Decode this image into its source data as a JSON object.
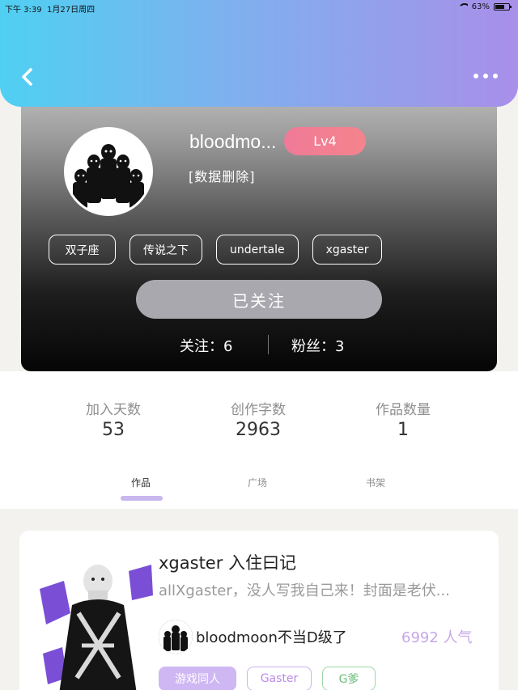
{
  "status_bar": {
    "time": "下午 3:39",
    "date": "1月27日周四",
    "battery": "63%"
  },
  "header": {
    "back_icon": "chevron-left-icon",
    "more_icon": "more-dots-icon",
    "gradient_colors": [
      "#4fd0f2",
      "#a88fe9"
    ]
  },
  "profile": {
    "username": "bloodmo...",
    "level": "Lv4",
    "bio": "[数据删除]",
    "tags": [
      "双子座",
      "传说之下",
      "undertale",
      "xgaster"
    ],
    "follow_button": "已关注",
    "following": "关注：6",
    "fans": "粉丝：3"
  },
  "stats": [
    {
      "label": "加入天数",
      "value": "53"
    },
    {
      "label": "创作字数",
      "value": "2963"
    },
    {
      "label": "作品数量",
      "value": "1"
    }
  ],
  "tabs": [
    {
      "label": "作品",
      "active": true
    },
    {
      "label": "广场",
      "active": false
    },
    {
      "label": "书架",
      "active": false
    }
  ],
  "work": {
    "title": "xgaster 入住曰记",
    "description": "allXgaster，没人写我自己来！封面是老伏...",
    "author": "bloodmoon不当D级了",
    "popularity": "6992 人气",
    "tags": [
      "游戏同人",
      "Gaster",
      "G爹"
    ]
  },
  "colors": {
    "accent": "#c9b6ee",
    "level_badge": "#f07a98",
    "popularity": "#c7a7ea"
  }
}
